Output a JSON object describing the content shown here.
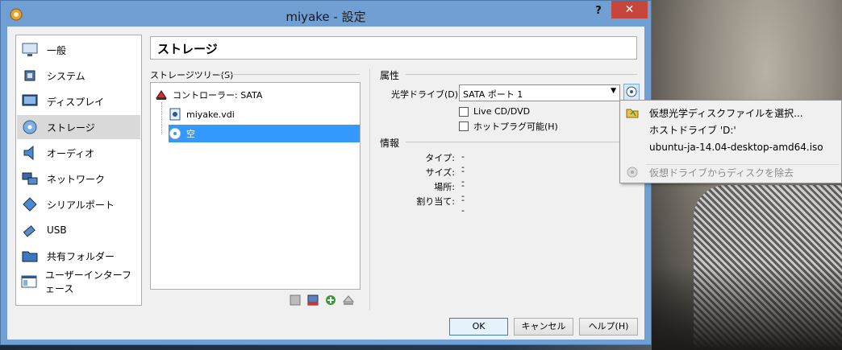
{
  "window": {
    "title": "miyake - 設定",
    "help_label": "?",
    "close_label": "✕"
  },
  "sidebar": {
    "items": [
      {
        "label": "一般",
        "icon": "monitor-icon"
      },
      {
        "label": "システム",
        "icon": "chip-icon"
      },
      {
        "label": "ディスプレイ",
        "icon": "display-icon"
      },
      {
        "label": "ストレージ",
        "icon": "storage-icon",
        "selected": true
      },
      {
        "label": "オーディオ",
        "icon": "speaker-icon"
      },
      {
        "label": "ネットワーク",
        "icon": "network-icon"
      },
      {
        "label": "シリアルポート",
        "icon": "serial-port-icon"
      },
      {
        "label": "USB",
        "icon": "usb-icon"
      },
      {
        "label": "共有フォルダー",
        "icon": "folder-icon"
      },
      {
        "label": "ユーザーインターフェース",
        "icon": "ui-icon"
      }
    ]
  },
  "page": {
    "heading": "ストレージ"
  },
  "tree": {
    "label": "ストレージツリー(S)",
    "controller": "コントローラー: SATA",
    "disk": "miyake.vdi",
    "optical": "空"
  },
  "attributes": {
    "label": "属性",
    "drive_label": "光学ドライブ(D):",
    "drive_value": "SATA ポート 1",
    "live_cd": "Live CD/DVD",
    "hotplug": "ホットプラグ可能(H)"
  },
  "info": {
    "label": "情報",
    "rows": [
      {
        "key": "タイプ:",
        "value": "--"
      },
      {
        "key": "サイズ:",
        "value": "--"
      },
      {
        "key": "場所:",
        "value": "--"
      },
      {
        "key": "割り当て:",
        "value": "--"
      }
    ]
  },
  "buttons": {
    "ok": "OK",
    "cancel": "キャンセル",
    "help": "ヘルプ(H)"
  },
  "menu": {
    "items": [
      {
        "label": "仮想光学ディスクファイルを選択...",
        "icon": "folder-open-icon"
      },
      {
        "label": "ホストドライブ 'D:'"
      },
      {
        "label": "ubuntu-ja-14.04-desktop-amd64.iso"
      },
      {
        "label": "仮想ドライブからディスクを除去",
        "icon": "eject-disc-icon",
        "disabled": true
      }
    ]
  },
  "colors": {
    "titlebar": "#6f9fd3",
    "close_button": "#c7463c",
    "selection": "#3399ff"
  }
}
